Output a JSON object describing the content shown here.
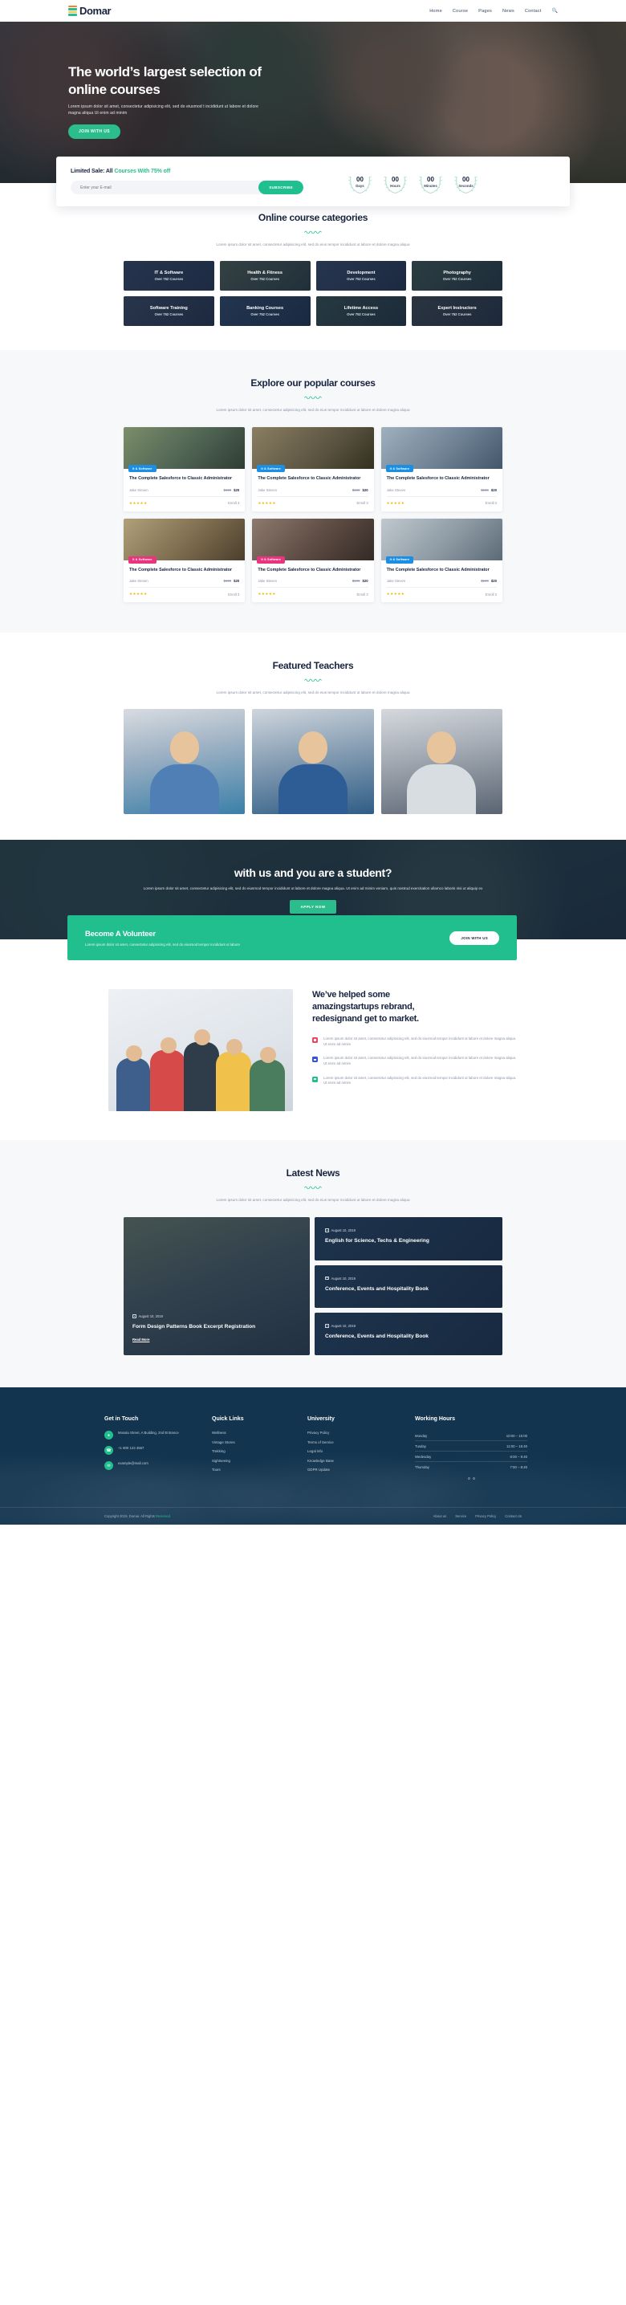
{
  "header": {
    "brand": "Domar",
    "nav": [
      {
        "label": "Home"
      },
      {
        "label": "Course"
      },
      {
        "label": "Pages"
      },
      {
        "label": "News"
      },
      {
        "label": "Contact"
      }
    ],
    "search_icon": "search-icon"
  },
  "hero": {
    "title_line1": "The world’s largest selection of",
    "title_line2": "online courses",
    "description": "Lorem ipsum dolor sit amet, consectetur adipisicing elit, sed do eiusmod t incididunt ut labore et dolore magna aliqua Ut enim ad minim",
    "cta": "JOIN WITH US"
  },
  "sale": {
    "title_prefix": "Limited Sale: All",
    "title_highlight": "Courses With 75% off",
    "email_placeholder": "Enter your E-mail",
    "email_value": "",
    "subscribe": "SUBSCRIBE",
    "counters": [
      {
        "value": "00",
        "label": "Days"
      },
      {
        "value": "00",
        "label": "Hours"
      },
      {
        "value": "00",
        "label": "Minutes"
      },
      {
        "value": "00",
        "label": "Seconds"
      }
    ]
  },
  "categories": {
    "title": "Online course categories",
    "description": "Lorem ipsum dolor sit amet, consectetur adipisicing elit, sed do eius tempor incididunt ut labore et dolore magna aliqua",
    "items": [
      {
        "name": "IT & Software",
        "sub": "Over 752 Courses"
      },
      {
        "name": "Health & Fitness",
        "sub": "Over 752 Courses"
      },
      {
        "name": "Development",
        "sub": "Over 752 Courses"
      },
      {
        "name": "Photography",
        "sub": "Over 752 Courses"
      },
      {
        "name": "Software Training",
        "sub": "Over 752 Courses"
      },
      {
        "name": "Banking Courses",
        "sub": "Over 752 Courses"
      },
      {
        "name": "Lifetime Access",
        "sub": "Over 752 Courses"
      },
      {
        "name": "Expert Instructors",
        "sub": "Over 752 Courses"
      }
    ]
  },
  "courses": {
    "title": "Explore our popular courses",
    "description": "Lorem ipsum dolor sit amet, consectetur adipisicing elit, sed do eius tempor incididunt ut labore et dolore magna aliqua",
    "items": [
      {
        "tag": "It & Software",
        "title": "The Complete Salesforce to Classic Administrator",
        "author": "Jake Steven",
        "old_price": "$199",
        "price": "$20",
        "stars": "★★★★★",
        "enroll": "Enroll 3"
      },
      {
        "tag": "It & Software",
        "title": "The Complete Salesforce to Classic Administrator",
        "author": "Jake Steven",
        "old_price": "$199",
        "price": "$20",
        "stars": "★★★★★",
        "enroll": "Enroll 3"
      },
      {
        "tag": "It & Software",
        "title": "The Complete Salesforce to Classic Administrator",
        "author": "Jake Steven",
        "old_price": "$199",
        "price": "$20",
        "stars": "★★★★★",
        "enroll": "Enroll 3"
      },
      {
        "tag": "It & Software",
        "title": "The Complete Salesforce to Classic Administrator",
        "author": "Jake Steven",
        "old_price": "$199",
        "price": "$20",
        "stars": "★★★★★",
        "enroll": "Enroll 3"
      },
      {
        "tag": "It & Software",
        "title": "The Complete Salesforce to Classic Administrator",
        "author": "Jake Steven",
        "old_price": "$199",
        "price": "$20",
        "stars": "★★★★★",
        "enroll": "Enroll 3"
      },
      {
        "tag": "It & Software",
        "title": "The Complete Salesforce to Classic Administrator",
        "author": "Jake Steven",
        "old_price": "$199",
        "price": "$20",
        "stars": "★★★★★",
        "enroll": "Enroll 3"
      }
    ]
  },
  "teachers": {
    "title": "Featured Teachers",
    "description": "Lorem ipsum dolor sit amet, consectetur adipisicing elit, sed do eius tempor incididunt ut labore et dolore magna aliqua",
    "items": [
      {
        "name": "teacher-1"
      },
      {
        "name": "teacher-2"
      },
      {
        "name": "teacher-3"
      }
    ]
  },
  "cta": {
    "title": "with us and you are a student?",
    "description": "Lorem ipsum dolor sit amet, consectetur adipisicing elit, sed do eiusmod tempor incididunt ut labore et dolore magna aliqua. Ut enim ad minim veniam, quis nostrud exercitation ullamco laboris nisi ut aliquip ex",
    "button": "APPLY NOW"
  },
  "volunteer": {
    "title": "Become A Volunteer",
    "description": "Lorem ipsum dolor sit amet, consectetur adipisicing elit, sed do eiusmod tempor incididunt ut labore",
    "button": "JOIN WITH US"
  },
  "helped": {
    "title_line1": "We’ve helped some",
    "title_line2": "amazingstartups rebrand,",
    "title_line3": "redesignand get to market.",
    "features": [
      {
        "color": "#f0465c",
        "text": "Lorem ipsum dolor sit amet, consectetur adipisicing elit, sed do eiusmod tempor incididunt ut labore et dolore magna aliqua. Ut enim ad minim"
      },
      {
        "color": "#3753d6",
        "text": "Lorem ipsum dolor sit amet, consectetur adipisicing elit, sed do eiusmod tempor incididunt ut labore et dolore magna aliqua. Ut enim ad minim"
      },
      {
        "color": "#20bf8d",
        "text": "Lorem ipsum dolor sit amet, consectetur adipisicing elit, sed do eiusmod tempor incididunt ut labore et dolore magna aliqua. Ut enim ad minim"
      }
    ]
  },
  "news": {
    "title": "Latest News",
    "description": "Lorem ipsum dolor sit amet, consectetur adipisicing elit, sed do eius tempor incididunt ut labore et dolore magna aliqua",
    "featured": {
      "date": "August 10, 2019",
      "title": "Form Design Patterns Book Excerpt Registration",
      "read_more": "Read More"
    },
    "items": [
      {
        "date": "August 10, 2019",
        "title": "English for Science, Techs & Engineering"
      },
      {
        "date": "August 10, 2019",
        "title": "Conference, Events and Hospitality Book"
      },
      {
        "date": "August 10, 2019",
        "title": "Conference, Events and Hospitality Book"
      }
    ]
  },
  "footer": {
    "contact": {
      "title": "Get in Touch",
      "address": "Mosalu Street, A Building, 2nd Entrance",
      "phone": "+1 800 123 4567",
      "email": "example@mail.com"
    },
    "quick": {
      "title": "Quick Links",
      "links": [
        "Wellness",
        "Vintage Stores",
        "Trekking",
        "Sightseeing",
        "Tours"
      ]
    },
    "university": {
      "title": "University",
      "links": [
        "Privacy Policy",
        "Terms of Service",
        "Legal info",
        "Knowledge Base",
        "GDPR Update"
      ]
    },
    "hours": {
      "title": "Working Hours",
      "rows": [
        {
          "day": "Monday",
          "time": "10:00 – 15:00"
        },
        {
          "day": "Tusday",
          "time": "11:00 – 15:40"
        },
        {
          "day": "Wedesday",
          "time": "8:00 – 9:40"
        },
        {
          "day": "Thursday",
          "time": "7:50 – 8:40"
        }
      ]
    },
    "bar": {
      "copyright_pre": "Copyright 2019, Domar. All Rights ",
      "copyright_link": "Reserved.",
      "links": [
        "About us",
        "Service",
        "Privacy Policy",
        "Contact Us"
      ]
    }
  },
  "colors": {
    "accent": "#20bf8d",
    "dark": "#17233e",
    "footer_bg": "#12344f",
    "tag_blue": "#1a8fe3",
    "tag_pink": "#e8357e",
    "star": "#f7b500"
  }
}
